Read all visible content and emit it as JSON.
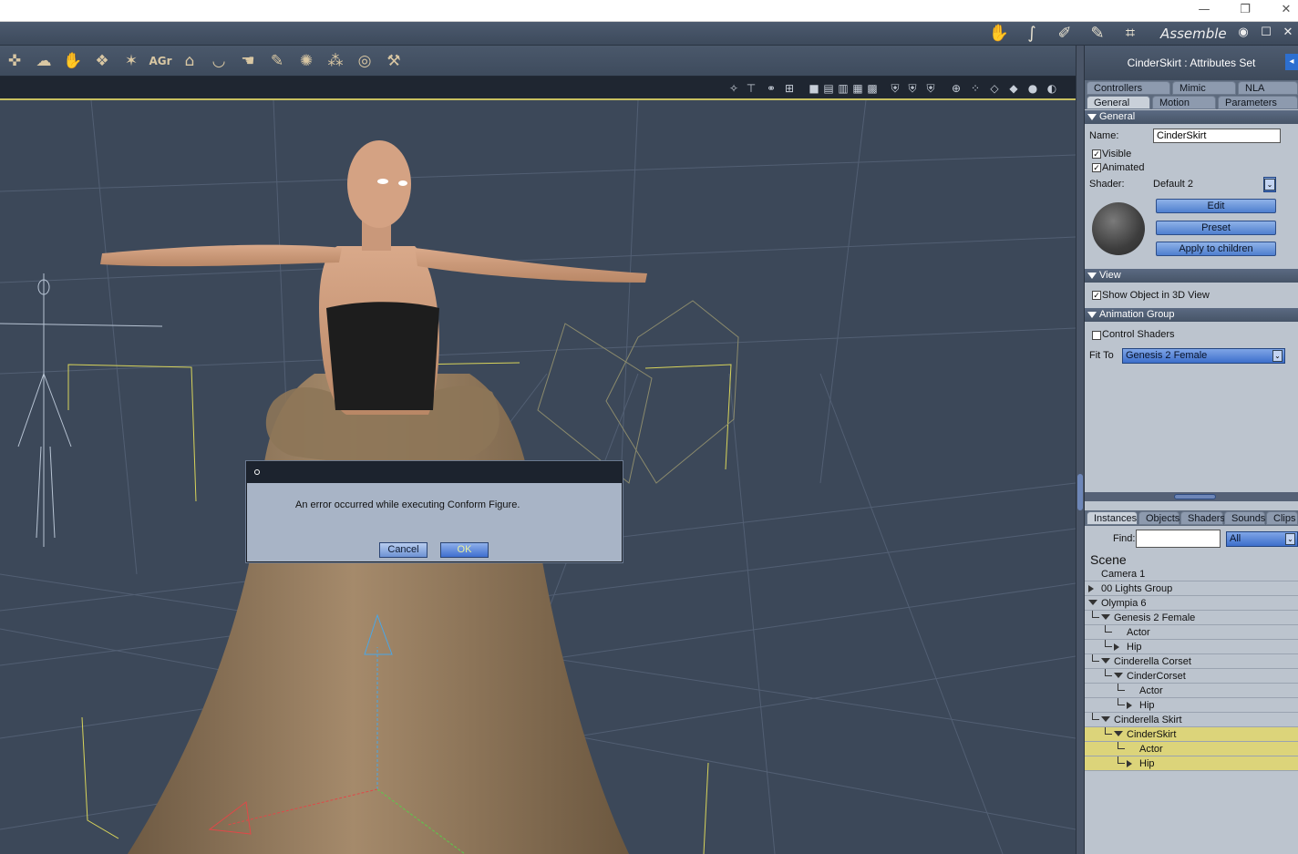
{
  "window": {
    "controls": {
      "minimize": "—",
      "restore": "❐",
      "close": "✕"
    }
  },
  "room_bar": {
    "title": "Assemble",
    "icons": [
      "hand-icon",
      "walk-icon",
      "pose-icon",
      "paint-icon",
      "cloth-icon"
    ],
    "controls": {
      "eye": "◉",
      "maximize": "☐",
      "close": "✕"
    }
  },
  "toolbar": {
    "tools": [
      {
        "name": "figure-tool-icon",
        "glyph": "✜"
      },
      {
        "name": "hair-tool-icon",
        "glyph": "☁"
      },
      {
        "name": "hand-tool-icon",
        "glyph": "✋"
      },
      {
        "name": "props-tool-icon",
        "glyph": "❖"
      },
      {
        "name": "deform-tool-icon",
        "glyph": "✶"
      },
      {
        "name": "text-tool-label",
        "glyph": "AGr"
      },
      {
        "name": "house-tool-icon",
        "glyph": "⌂"
      },
      {
        "name": "bowl-tool-icon",
        "glyph": "◡"
      },
      {
        "name": "pose-hand-tool-icon",
        "glyph": "☚"
      },
      {
        "name": "pin-tool-icon",
        "glyph": "✎"
      },
      {
        "name": "camera-tool-icon",
        "glyph": "✺"
      },
      {
        "name": "move-tool-icon",
        "glyph": "⁂"
      },
      {
        "name": "target-tool-icon",
        "glyph": "◎"
      },
      {
        "name": "wrench-tool-icon",
        "glyph": "⚒"
      }
    ]
  },
  "viewport_toolbar": {
    "icons": [
      "✧",
      "⊤",
      "⚭",
      "⊞",
      "■",
      "▤",
      "▥",
      "▦",
      "▩",
      "⛨",
      "⛨",
      "⛨",
      "⊕",
      "⁘",
      "◇",
      "◆",
      "●",
      "◐"
    ]
  },
  "attributes": {
    "header": "CinderSkirt : Attributes Set",
    "collapse": "◂",
    "tabs_top": [
      "Controllers",
      "Mimic",
      "NLA"
    ],
    "tabs_bottom": [
      "General",
      "Motion",
      "Parameters"
    ],
    "general": {
      "title": "General",
      "name_label": "Name:",
      "name_value": "CinderSkirt",
      "visible_label": "Visible",
      "visible": true,
      "animated_label": "Animated",
      "animated": true,
      "shader_label": "Shader:",
      "shader_value": "Default 2",
      "edit_label": "Edit",
      "preset_label": "Preset",
      "apply_label": "Apply to children"
    },
    "view": {
      "title": "View",
      "show_label": "Show Object in 3D View",
      "show": true
    },
    "animation_group": {
      "title": "Animation Group",
      "control_shaders_label": "Control Shaders",
      "control_shaders": false,
      "fit_to_label": "Fit To",
      "fit_to_value": "Genesis 2 Female"
    }
  },
  "library": {
    "tabs": [
      "Instances",
      "Objects",
      "Shaders",
      "Sounds",
      "Clips"
    ],
    "find_label": "Find:",
    "find_value": "",
    "filter_value": "All",
    "scene_title": "Scene",
    "tree": [
      {
        "label": "Camera 1",
        "depth": 0,
        "expander": "none",
        "selected": false
      },
      {
        "label": "00 Lights Group",
        "depth": 0,
        "expander": "closed",
        "selected": false
      },
      {
        "label": "Olympia 6",
        "depth": 0,
        "expander": "open",
        "selected": false
      },
      {
        "label": "Genesis 2 Female",
        "depth": 1,
        "expander": "open",
        "selected": false
      },
      {
        "label": "Actor",
        "depth": 2,
        "expander": "none",
        "selected": false
      },
      {
        "label": "Hip",
        "depth": 2,
        "expander": "closed",
        "selected": false
      },
      {
        "label": "Cinderella Corset",
        "depth": 1,
        "expander": "open",
        "selected": false
      },
      {
        "label": "CinderCorset",
        "depth": 2,
        "expander": "open",
        "selected": false
      },
      {
        "label": "Actor",
        "depth": 3,
        "expander": "none",
        "selected": false
      },
      {
        "label": "Hip",
        "depth": 3,
        "expander": "closed",
        "selected": false
      },
      {
        "label": "Cinderella Skirt",
        "depth": 1,
        "expander": "open",
        "selected": false
      },
      {
        "label": "CinderSkirt",
        "depth": 2,
        "expander": "open",
        "selected": true
      },
      {
        "label": "Actor",
        "depth": 3,
        "expander": "none",
        "selected": true
      },
      {
        "label": "Hip",
        "depth": 3,
        "expander": "closed",
        "selected": true
      }
    ]
  },
  "dialog": {
    "message": "An error occurred while executing Conform Figure.",
    "cancel_label": "Cancel",
    "ok_label": "OK"
  }
}
